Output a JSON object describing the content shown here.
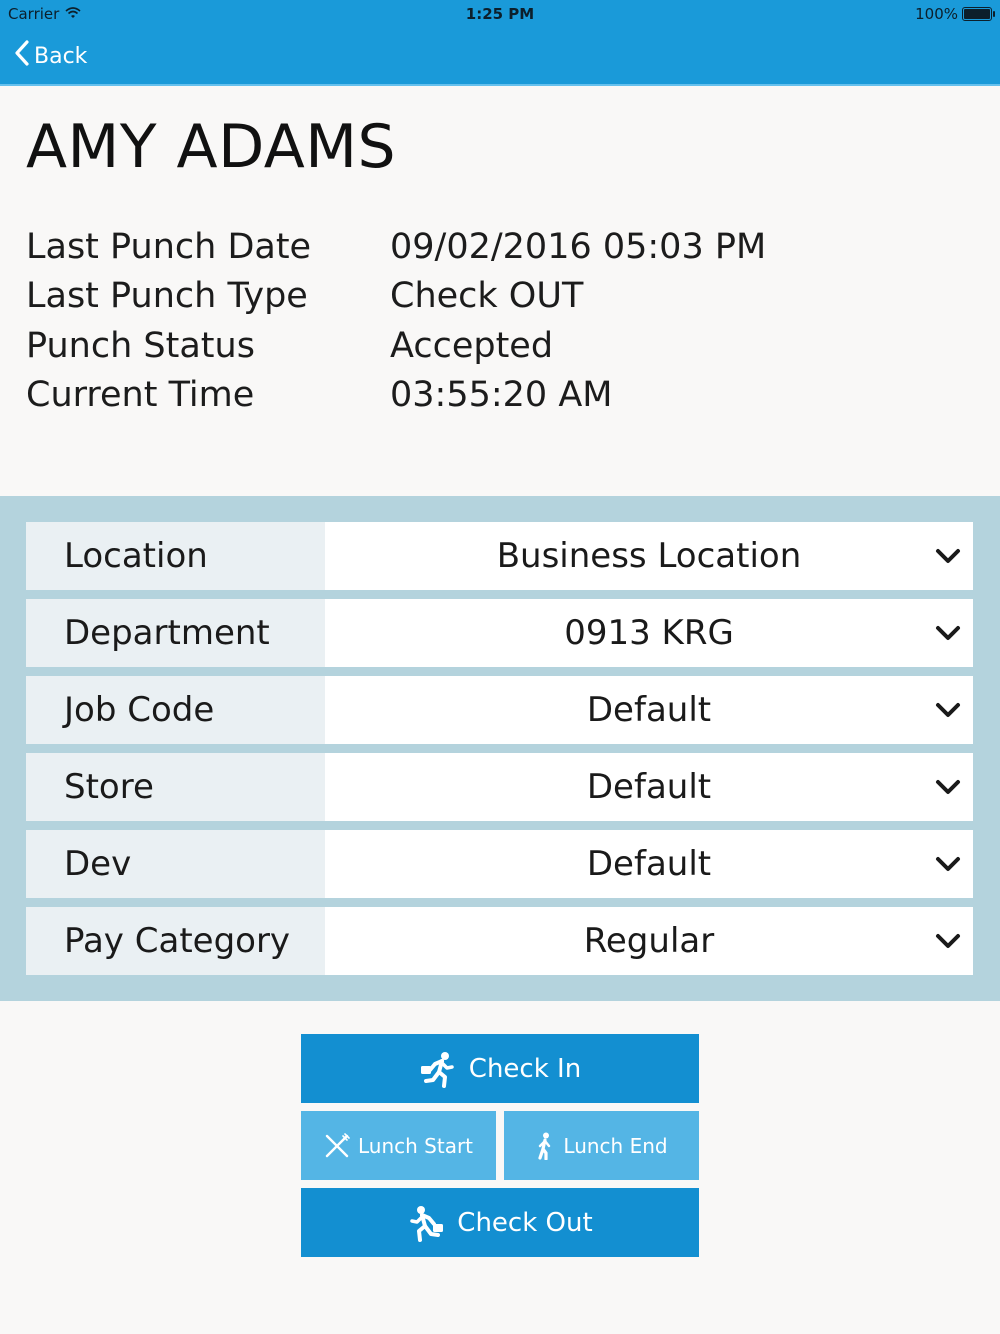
{
  "status_bar": {
    "carrier": "Carrier",
    "time": "1:25 PM",
    "battery": "100%"
  },
  "nav": {
    "back_label": "Back"
  },
  "employee": {
    "name": "AMY ADAMS"
  },
  "punch_info": [
    {
      "label": "Last Punch Date",
      "value": "09/02/2016 05:03 PM"
    },
    {
      "label": "Last Punch Type",
      "value": "Check OUT"
    },
    {
      "label": "Punch Status",
      "value": "Accepted"
    },
    {
      "label": "Current Time",
      "value": "03:55:20 AM"
    }
  ],
  "selectors": [
    {
      "label": "Location",
      "value": "Business Location"
    },
    {
      "label": "Department",
      "value": "0913 KRG"
    },
    {
      "label": "Job Code",
      "value": "Default"
    },
    {
      "label": "Store",
      "value": "Default"
    },
    {
      "label": "Dev",
      "value": "Default"
    },
    {
      "label": "Pay Category",
      "value": "Regular"
    }
  ],
  "actions": {
    "check_in": "Check In",
    "lunch_start": "Lunch Start",
    "lunch_end": "Lunch End",
    "check_out": "Check Out"
  },
  "colors": {
    "primary": "#1a9ad9",
    "button_primary": "#138fd1",
    "button_secondary": "#54b5e5",
    "panel_bg": "#b4d3dd"
  },
  "icons": {
    "wifi": "wifi-icon",
    "battery": "battery-icon",
    "back": "chevron-left-icon",
    "dropdown": "chevron-down-icon",
    "check_in": "running-person-icon",
    "lunch_start": "fork-knife-icon",
    "lunch_end": "walking-person-icon",
    "check_out": "running-person-icon"
  }
}
